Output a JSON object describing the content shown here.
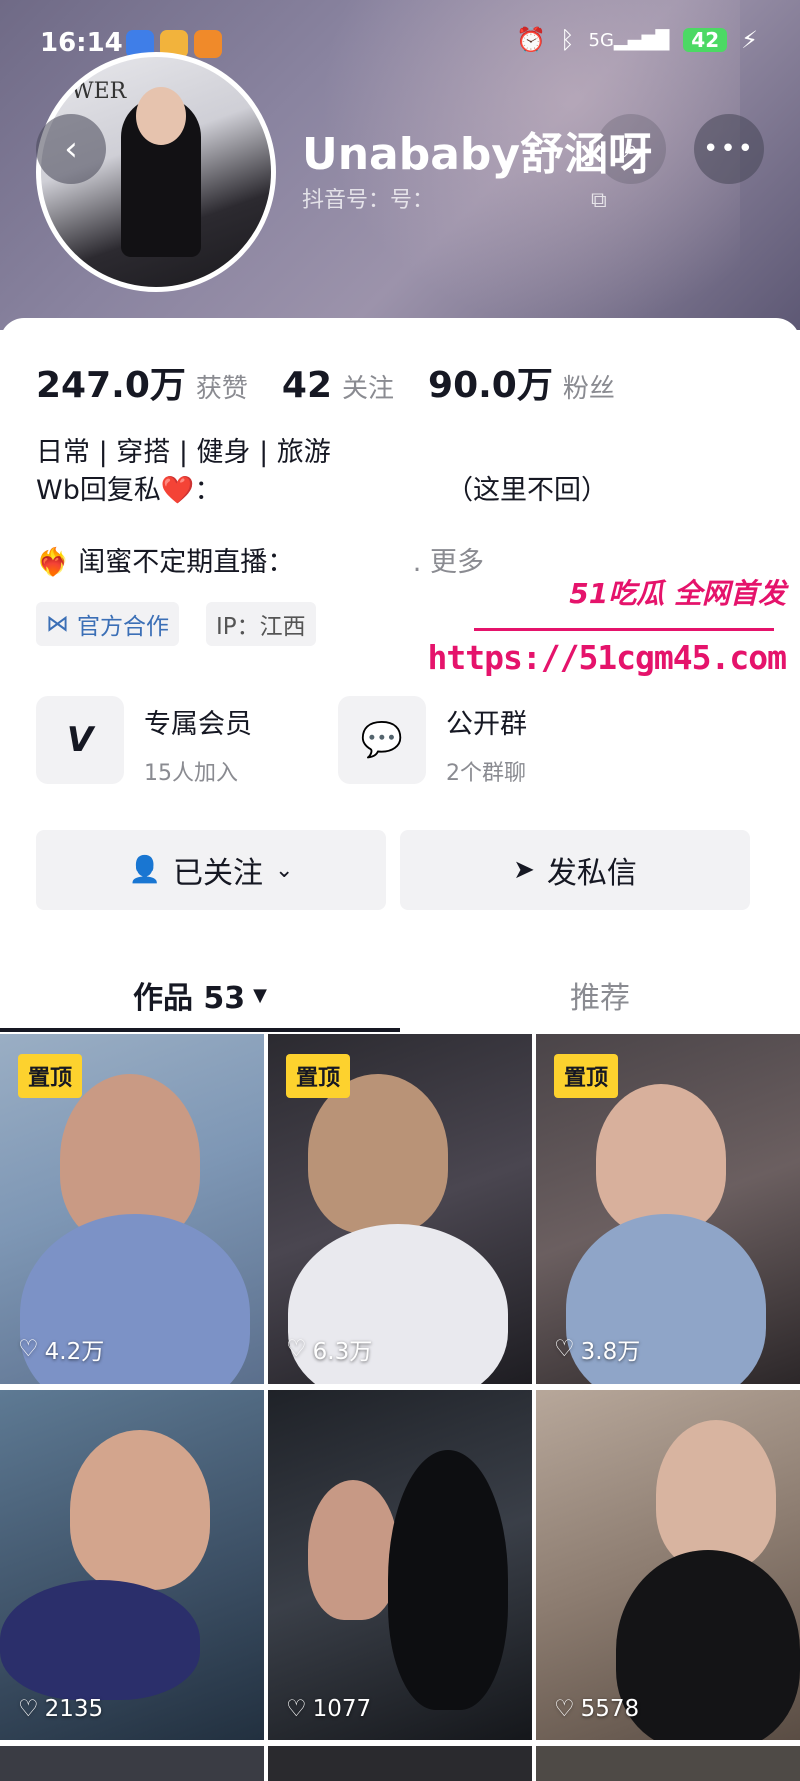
{
  "status_bar": {
    "time": "16:14",
    "network": "5G",
    "battery": "42"
  },
  "profile": {
    "nickname": "Unababy舒涵呀",
    "douyin_id": "抖音号：号：",
    "avatar_text": "WER"
  },
  "stats": [
    {
      "value": "247.0万",
      "label": "获赞"
    },
    {
      "value": "42",
      "label": "关注"
    },
    {
      "value": "90.0万",
      "label": "粉丝"
    }
  ],
  "bio": {
    "line1": "日常 | 穿搭 | 健身 | 旅游",
    "line2_prefix": "Wb回复私❤️：",
    "line2_suffix": "（这里不回）",
    "line3_prefix": "❤️‍🔥 闺蜜不定期直播：",
    "line3_more": ". 更多"
  },
  "tags": [
    {
      "icon": "handshake-icon",
      "label": "官方合作"
    },
    {
      "icon": "",
      "label": "IP：江西"
    }
  ],
  "features": [
    {
      "icon": "v-icon",
      "title": "专属会员",
      "subtitle": "15人加入"
    },
    {
      "icon": "chat-bubbles-icon",
      "title": "公开群",
      "subtitle": "2个群聊"
    }
  ],
  "actions": {
    "follow_label": "已关注",
    "message_label": "发私信"
  },
  "watermark": {
    "brand": "51吃瓜 全网首发",
    "url": "https://51cgm45.com"
  },
  "tabs": [
    {
      "label": "作品 53"
    },
    {
      "label": "推荐"
    }
  ],
  "posts": [
    {
      "pinned": "置顶",
      "likes": "4.2万"
    },
    {
      "pinned": "置顶",
      "likes": "6.3万"
    },
    {
      "pinned": "置顶",
      "likes": "3.8万"
    },
    {
      "pinned": "",
      "likes": "2135"
    },
    {
      "pinned": "",
      "likes": "1077"
    },
    {
      "pinned": "",
      "likes": "5578"
    }
  ],
  "colors": {
    "accent": "#e5136b",
    "pin_badge": "#fdd22e",
    "text": "#161823",
    "muted": "#8a8b91"
  }
}
